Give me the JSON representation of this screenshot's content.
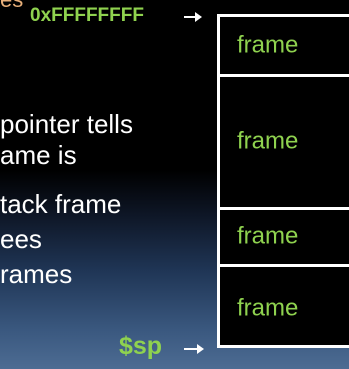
{
  "slide": {
    "top_fragment": "es",
    "lines": [
      "pointer tells",
      "ame is",
      "tack frame",
      "ees",
      "rames"
    ]
  },
  "labels": {
    "top_address": "0xFFFFFFFF",
    "stack_pointer": "$sp"
  },
  "stack": {
    "frames": [
      "frame",
      "frame",
      "frame",
      "frame"
    ]
  },
  "colors": {
    "address_text": "#8fd24f",
    "top_fragment": "#e9b07a",
    "body_text": "#ffffff"
  }
}
